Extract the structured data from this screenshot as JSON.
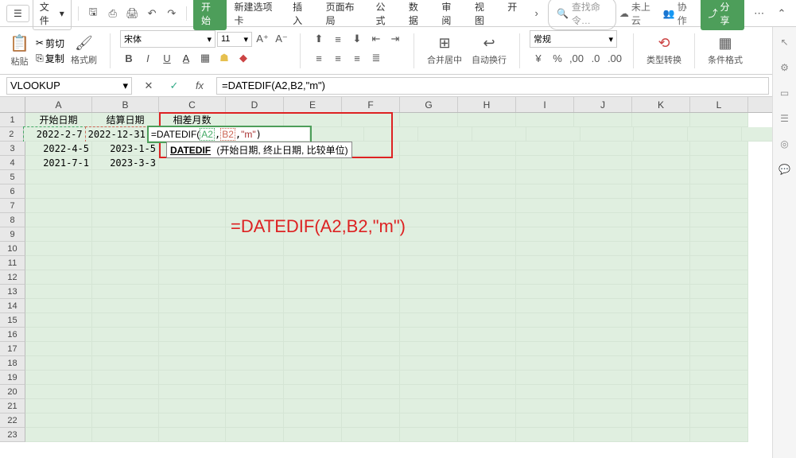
{
  "menu": {
    "file": "文件",
    "tabs": [
      "开始",
      "新建选项卡",
      "插入",
      "页面布局",
      "公式",
      "数据",
      "审阅",
      "视图",
      "开"
    ],
    "active_tab": 0,
    "search_placeholder": "查找命令…",
    "cloud": "未上云",
    "collab": "协作",
    "share": "分享"
  },
  "ribbon": {
    "paste": "粘贴",
    "cut": "剪切",
    "copy": "复制",
    "format_painter": "格式刷",
    "font_name": "宋体",
    "font_size": "11",
    "merge_center": "合并居中",
    "wrap_text": "自动换行",
    "number_format": "常规",
    "type_convert": "类型转换",
    "cond_format": "条件格式"
  },
  "fbar": {
    "name": "VLOOKUP",
    "formula": "=DATEDIF(A2,B2,\"m\")"
  },
  "columns": [
    "A",
    "B",
    "C",
    "D",
    "E",
    "F",
    "G",
    "H",
    "I",
    "J",
    "K",
    "L"
  ],
  "rows": 23,
  "cells": {
    "A1": "开始日期",
    "B1": "结算日期",
    "C1": "相差月数",
    "A2": "2022-2-7",
    "B2": "2022-12-31",
    "A3": "2022-4-5",
    "B3": "2023-1-5",
    "A4": "2021-7-1",
    "B4": "2023-3-3"
  },
  "editing": {
    "ref": "C2",
    "parts": [
      "=DATEDIF(",
      "A2",
      ",",
      "B2",
      ",",
      "\"m\"",
      ")"
    ]
  },
  "tooltip": {
    "fn": "DATEDIF",
    "sig": "(开始日期, 终止日期, 比较单位)"
  },
  "annotation": {
    "text": "=DATEDIF(A2,B2,\"m\")"
  }
}
